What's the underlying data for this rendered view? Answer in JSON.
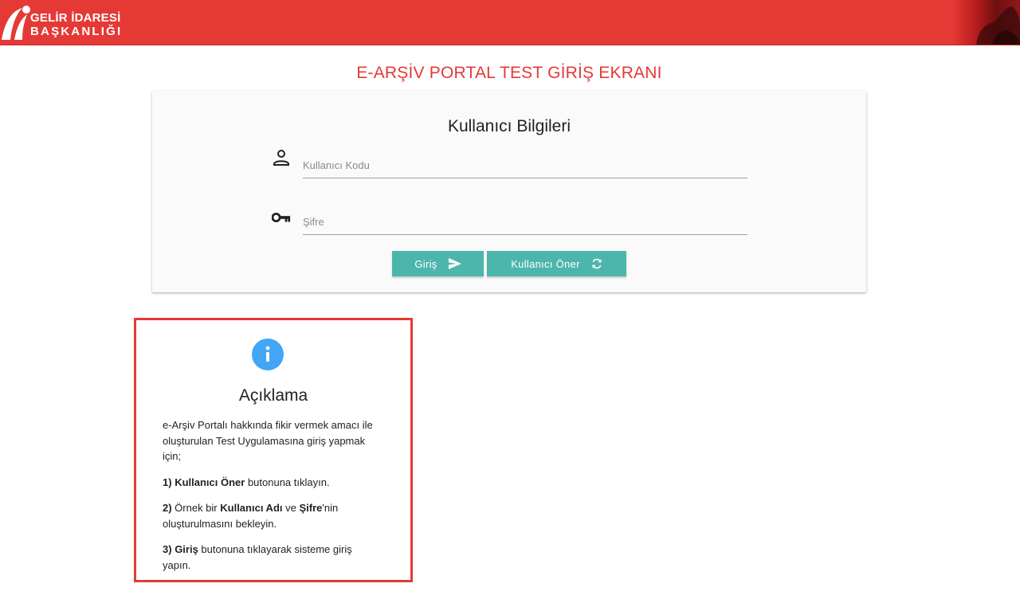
{
  "header": {
    "logo_line1": "GELİR İDARESİ",
    "logo_line2": "BAŞKANLIĞI",
    "brand_color": "#e53935"
  },
  "page_title": "E-ARŞİV PORTAL TEST GİRİŞ EKRANI",
  "login": {
    "title": "Kullanıcı Bilgileri",
    "username_placeholder": "Kullanıcı Kodu",
    "username_value": "",
    "password_placeholder": "Şifre",
    "password_value": "",
    "user_icon": "person-icon",
    "password_icon": "key-icon",
    "login_button": "Giriş",
    "login_button_icon": "send-icon",
    "suggest_button": "Kullanıcı Öner",
    "suggest_button_icon": "refresh-icon",
    "button_color": "#4db6ac"
  },
  "info": {
    "icon": "info-icon",
    "icon_color": "#42a5f5",
    "title": "Açıklama",
    "intro": "e-Arşiv Portalı hakkında fikir vermek amacı ile oluşturulan Test Uygulamasına giriş yapmak için;",
    "step1_num": "1)",
    "step1_bold": "Kullanıcı Öner",
    "step1_text": " butonuna tıklayın.",
    "step2_num": "2)",
    "step2_text_a": " Örnek bir ",
    "step2_bold_a": "Kullanıcı Adı",
    "step2_text_b": " ve ",
    "step2_bold_b": "Şifre",
    "step2_text_c": "'nin oluşturulmasını bekleyin.",
    "step3_num": "3)",
    "step3_bold": "Giriş",
    "step3_text": " butonuna tıklayarak sisteme giriş yapın.",
    "border_color": "#e53935"
  }
}
